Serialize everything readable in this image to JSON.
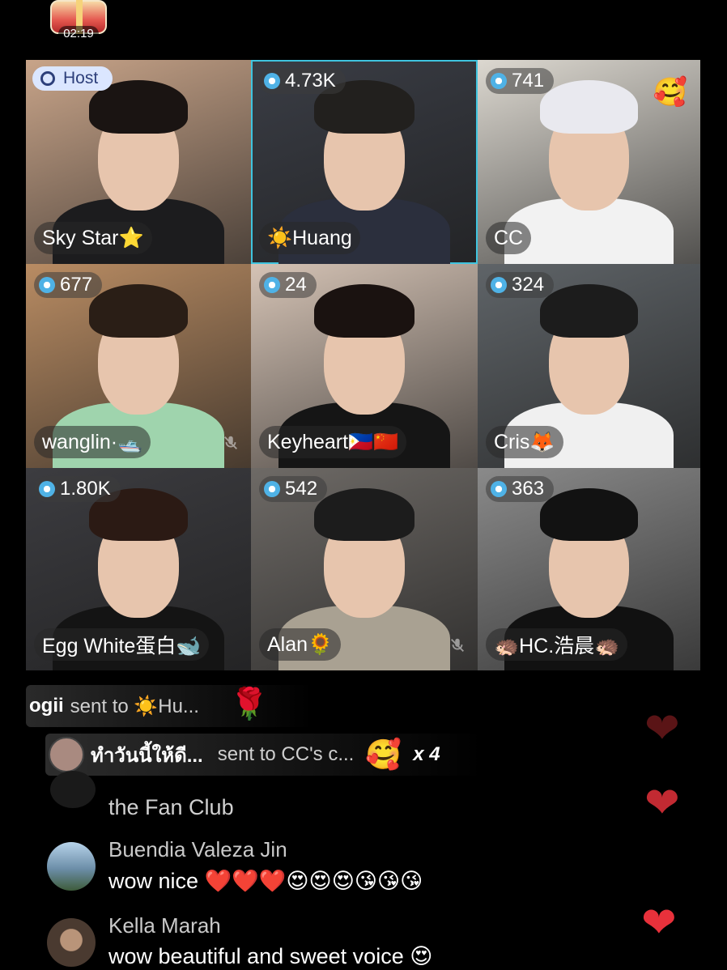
{
  "treasure": {
    "timer": "02:19"
  },
  "host_label": "Host",
  "tiles": [
    {
      "count": "",
      "name": "Sky Star⭐",
      "host": true,
      "muted": false,
      "active": false,
      "bg": "#c8a489",
      "shirt": "#1c1c1e",
      "hair": "#1a1412"
    },
    {
      "count": "4.73K",
      "name": "☀️Huang",
      "host": false,
      "muted": false,
      "active": true,
      "bg": "#3a3d45",
      "shirt": "#2b2f3d",
      "hair": "#22201e"
    },
    {
      "count": "741",
      "name": "CC",
      "host": false,
      "muted": false,
      "active": false,
      "bg": "#dcd8d0",
      "shirt": "#f2f2f2",
      "hair": "#e9e9ef",
      "sticker": "🥰"
    },
    {
      "count": "677",
      "name": "wanglin·🛥️",
      "host": false,
      "muted": true,
      "active": false,
      "bg": "#b98c63",
      "shirt": "#9fd4ad",
      "hair": "#2a1e16"
    },
    {
      "count": "24",
      "name": "Keyheart🇵🇭🇨🇳",
      "host": false,
      "muted": false,
      "active": false,
      "bg": "#d5c3b5",
      "shirt": "#151515",
      "hair": "#1a1210"
    },
    {
      "count": "324",
      "name": "Cris🦊",
      "host": false,
      "muted": false,
      "active": false,
      "bg": "#5f6468",
      "shirt": "#f0f0f0",
      "hair": "#1c1c1c"
    },
    {
      "count": "1.80K",
      "name": "Egg White蛋白🐋",
      "host": false,
      "muted": false,
      "active": false,
      "bg": "#3c3c40",
      "shirt": "#141414",
      "hair": "#2b1a14"
    },
    {
      "count": "542",
      "name": "Alan🌻",
      "host": false,
      "muted": true,
      "active": false,
      "bg": "#6e6a66",
      "shirt": "#a9a192",
      "hair": "#1c1c1c"
    },
    {
      "count": "363",
      "name": "🦔HC.浩晨🦔",
      "host": false,
      "muted": false,
      "active": false,
      "bg": "#8a8a8a",
      "shirt": "#111111",
      "hair": "#121212"
    }
  ],
  "gifts": [
    {
      "sender": "ogii",
      "text": "sent to ☀️Hu...",
      "emoji": "🌹"
    },
    {
      "sender": "ทำวันนี้ให้ดี...",
      "text": "sent to CC's c...",
      "emoji": "🥰",
      "multiplier": "x 4"
    }
  ],
  "system_message": "the Fan Club",
  "comments": [
    {
      "user": "Buendia Valeza Jin",
      "message": "wow nice ❤️❤️❤️😍😍😍😘😘😘"
    },
    {
      "user": "Kella Marah",
      "message": "wow beautiful and sweet voice 😍"
    }
  ],
  "colors": {
    "accent": "#3fc4df",
    "heart": "#e8313b"
  }
}
